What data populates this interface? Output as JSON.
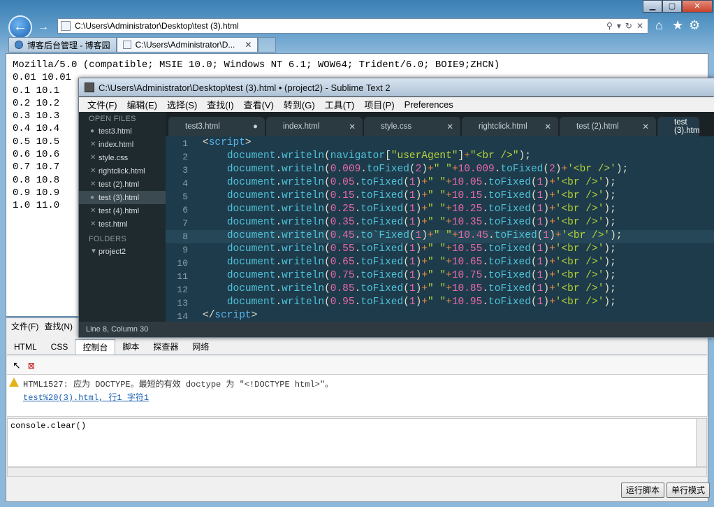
{
  "browser": {
    "address": "C:\\Users\\Administrator\\Desktop\\test (3).html",
    "tabs": [
      {
        "label": "博客后台管理 - 博客园"
      },
      {
        "label": "C:\\Users\\Administrator\\D..."
      }
    ]
  },
  "page_output": "Mozilla/5.0 (compatible; MSIE 10.0; Windows NT 6.1; WOW64; Trident/6.0; BOIE9;ZHCN)\n0.01 10.01\n0.1 10.1\n0.2 10.2\n0.3 10.3\n0.4 10.4\n0.5 10.5\n0.6 10.6\n0.7 10.7\n0.8 10.8\n0.9 10.9\n1.0 11.0",
  "devtools": {
    "menu": [
      "文件(F)",
      "查找(N)"
    ],
    "tabs": [
      "HTML",
      "CSS",
      "控制台",
      "脚本",
      "探查器",
      "网络"
    ],
    "active_tab": "控制台",
    "warning": "HTML1527: 应为 DOCTYPE。最短的有效 doctype 为 \"<!DOCTYPE html>\"。",
    "warning_link": "test%20(3).html, 行1 字符1",
    "console_input": "console.clear()",
    "run_button": "运行脚本",
    "mode_button": "单行模式"
  },
  "sublime": {
    "title": "C:\\Users\\Administrator\\Desktop\\test (3).html • (project2) - Sublime Text 2",
    "menu": [
      "文件(F)",
      "编辑(E)",
      "选择(S)",
      "查找(I)",
      "查看(V)",
      "转到(G)",
      "工具(T)",
      "项目(P)",
      "Preferences"
    ],
    "open_files_header": "OPEN FILES",
    "open_files": [
      "test3.html",
      "index.html",
      "style.css",
      "rightclick.html",
      "test (2).html",
      "test (3).html",
      "test (4).html",
      "test.html"
    ],
    "folders_header": "FOLDERS",
    "folder": "project2",
    "tabs": [
      "test3.html",
      "index.html",
      "style.css",
      "rightclick.html",
      "test (2).html",
      "test (3).htm"
    ],
    "status": "Line 8, Column 30",
    "line_numbers": [
      "1",
      "2",
      "3",
      "4",
      "5",
      "6",
      "7",
      "8",
      "9",
      "10",
      "11",
      "12",
      "13",
      "14"
    ]
  }
}
